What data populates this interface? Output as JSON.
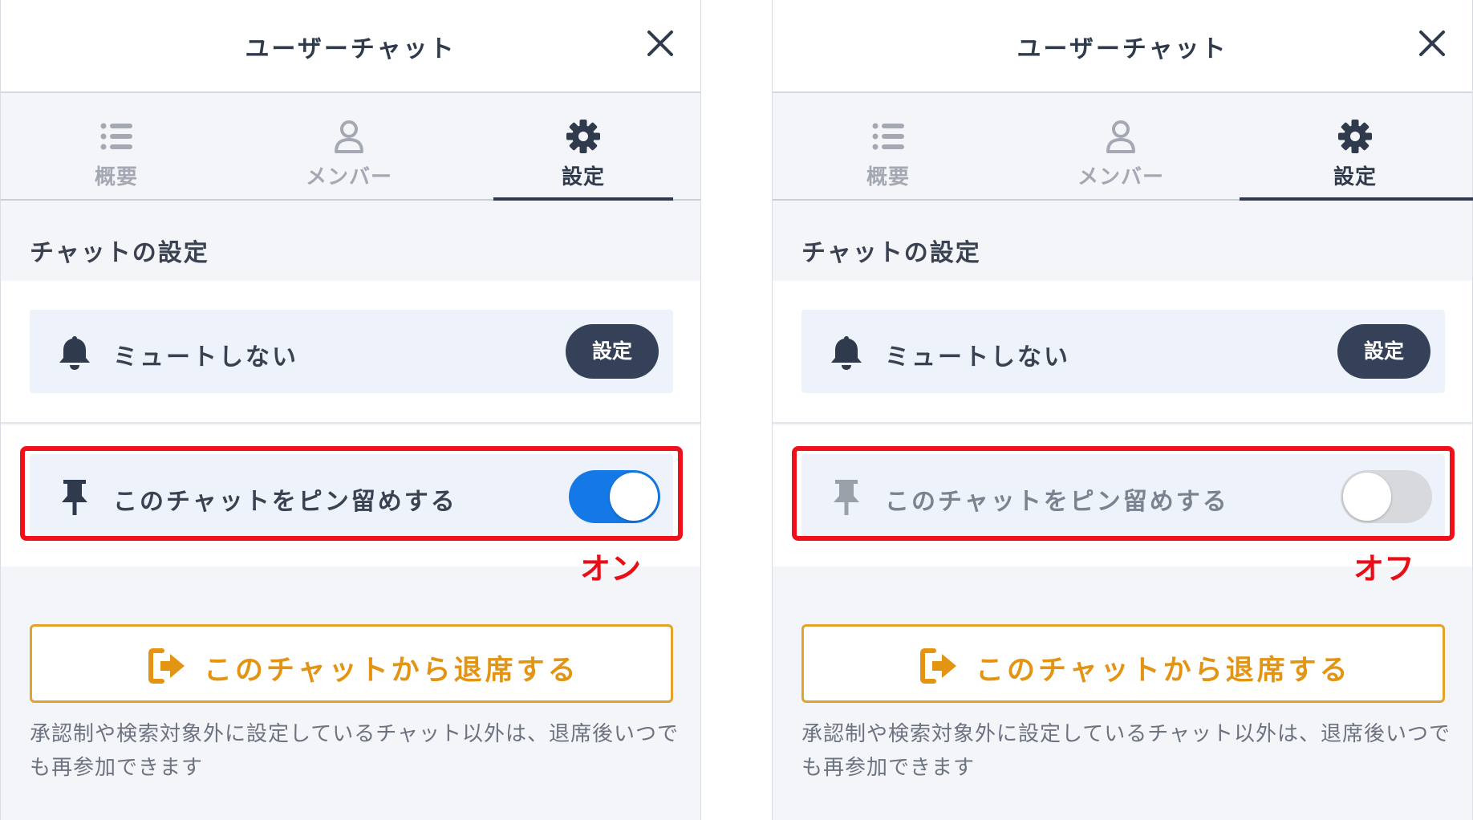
{
  "panels": [
    {
      "header": {
        "title": "ユーザーチャット"
      },
      "tabs": [
        {
          "label": "概要",
          "icon": "list-icon",
          "active": false
        },
        {
          "label": "メンバー",
          "icon": "user-icon",
          "active": false
        },
        {
          "label": "設定",
          "icon": "gear-icon",
          "active": true
        }
      ],
      "section_title": "チャットの設定",
      "mute": {
        "label": "ミュートしない",
        "button_label": "設定",
        "icon": "bell-icon"
      },
      "pin": {
        "label": "このチャットをピン留めする",
        "icon": "pin-icon",
        "toggle_state": "on"
      },
      "annotation": "オン",
      "leave_button": {
        "label": "このチャットから退席する",
        "icon": "sign-out-icon"
      },
      "note": "承認制や検索対象外に設定しているチャット以外は、退席後いつでも再参加できます"
    },
    {
      "header": {
        "title": "ユーザーチャット"
      },
      "tabs": [
        {
          "label": "概要",
          "icon": "list-icon",
          "active": false
        },
        {
          "label": "メンバー",
          "icon": "user-icon",
          "active": false
        },
        {
          "label": "設定",
          "icon": "gear-icon",
          "active": true
        }
      ],
      "section_title": "チャットの設定",
      "mute": {
        "label": "ミュートしない",
        "button_label": "設定",
        "icon": "bell-icon"
      },
      "pin": {
        "label": "このチャットをピン留めする",
        "icon": "pin-icon",
        "toggle_state": "off"
      },
      "annotation": "オフ",
      "leave_button": {
        "label": "このチャットから退席する",
        "icon": "sign-out-icon"
      },
      "note": "承認制や検索対象外に設定しているチャット以外は、退席後いつでも再参加できます"
    }
  ],
  "colors": {
    "accent_dark": "#354158",
    "toggle_on": "#1479e6",
    "toggle_off": "#d7d9dd",
    "highlight_red": "#f0101a",
    "leave_orange": "#e29412"
  }
}
